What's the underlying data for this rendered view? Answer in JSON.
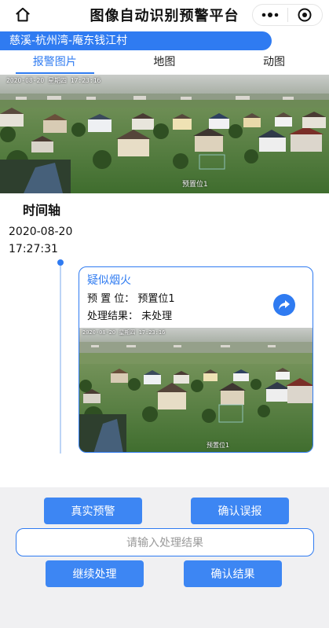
{
  "header": {
    "title": "图像自动识别预警平台",
    "home_icon": "home-icon",
    "more_icon": "more-dots-icon",
    "close_icon": "target-close-icon"
  },
  "location": "慈溪-杭州湾-庵东钱江村",
  "tabs": [
    {
      "label": "报警图片",
      "active": true
    },
    {
      "label": "地图",
      "active": false
    },
    {
      "label": "动图",
      "active": false
    }
  ],
  "hero_image": {
    "timestamp": "2020-08-20 星期四 17:23:16",
    "preset_label": "预置位1"
  },
  "timeline": {
    "title": "时间轴",
    "date": "2020-08-20",
    "time": "17:27:31"
  },
  "alarm_card": {
    "type": "疑似烟火",
    "preset_row": "预 置 位： 预置位1",
    "result_row": "处理结果： 未处理",
    "share_icon": "share-arrow-icon",
    "image_timestamp": "2020-08-20 星期四 17:23:16",
    "image_preset_label": "预置位1"
  },
  "actions": {
    "true_alarm": "真实预警",
    "confirm_false": "确认误报",
    "input_placeholder": "请输入处理结果",
    "continue": "继续处理",
    "confirm_result": "确认结果"
  },
  "colors": {
    "accent": "#2f7bf1",
    "button": "#3d86f3",
    "panel_bg": "#f0f0f2"
  }
}
